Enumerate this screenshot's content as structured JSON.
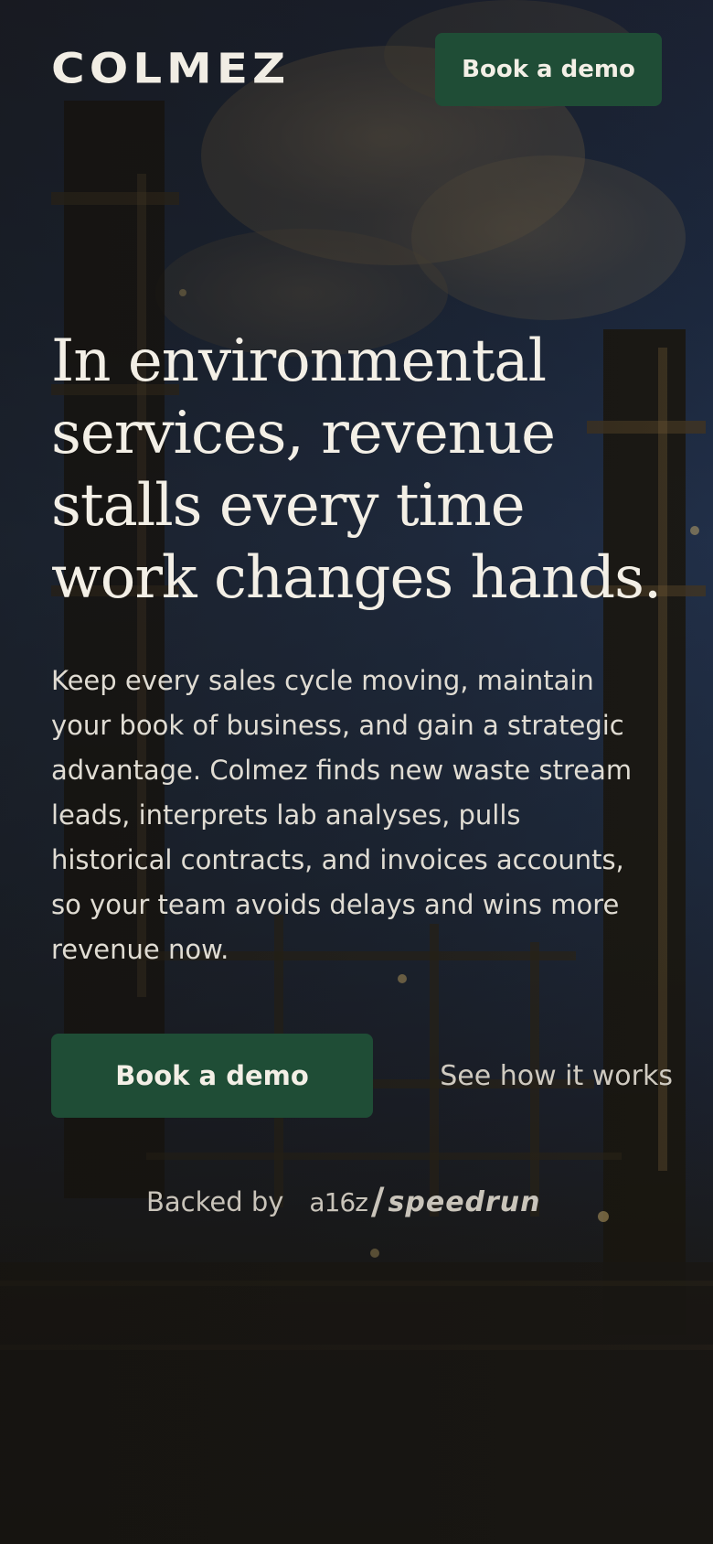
{
  "header": {
    "logo_text": "COLMEZ",
    "demo_button_label": "Book a demo"
  },
  "hero": {
    "headline_lines": [
      "In environmental",
      "services, revenue",
      "stalls every time",
      "work changes hands."
    ],
    "subtext_lines": [
      "Keep every sales cycle moving, maintain",
      "your book of business, and gain a strategic",
      "advantage. Colmez finds new waste stream",
      "leads, interprets lab analyses, pulls",
      "historical contracts, and invoices accounts,",
      "so your team avoids delays and wins more",
      "revenue now."
    ],
    "primary_cta_label": "Book a demo",
    "secondary_cta_label": "See how it works"
  },
  "backers": {
    "label": "Backed by",
    "logo_parts": {
      "a16z": "a16z",
      "slash": "/",
      "speedrun": "speedrun"
    }
  },
  "colors": {
    "brand_green": "#1f4d36",
    "text_light": "#f3efe6",
    "text_muted": "#c9c4ba"
  }
}
